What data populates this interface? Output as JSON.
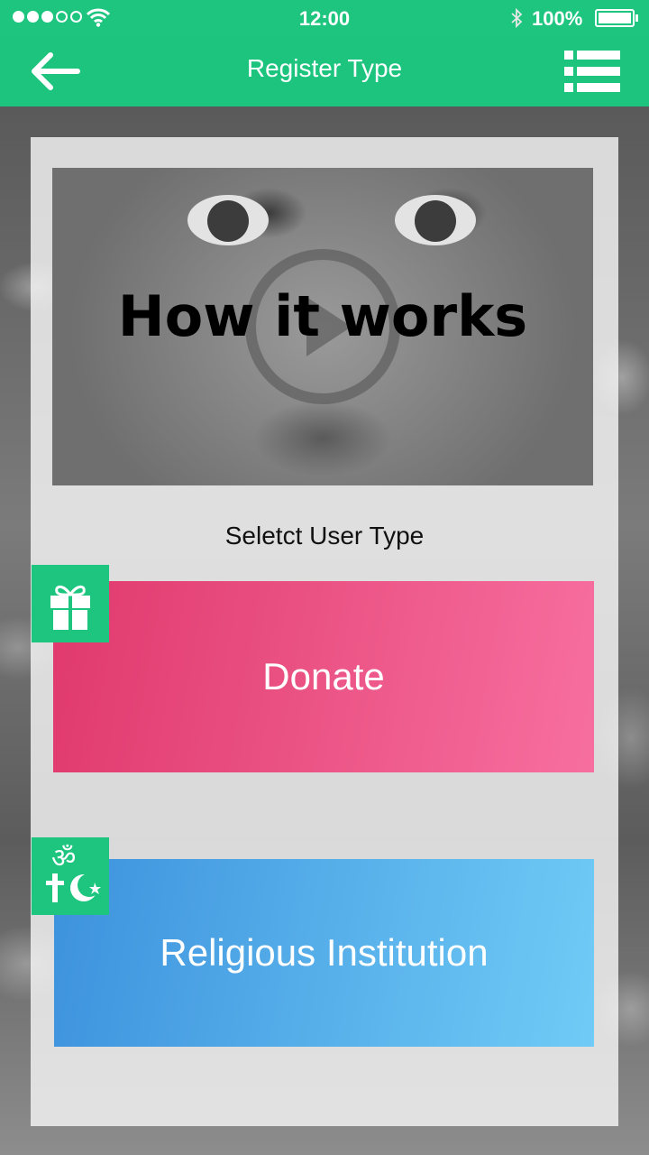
{
  "status_bar": {
    "time": "12:00",
    "battery_percent": "100%",
    "signal_dots_filled": 3,
    "signal_dots_total": 5,
    "icons": [
      "signal-dots-icon",
      "wifi-icon",
      "bluetooth-icon",
      "battery-icon"
    ]
  },
  "navbar": {
    "title": "Register Type",
    "back_icon": "back-arrow-icon",
    "menu_icon": "list-menu-icon",
    "color": "#1cc47e"
  },
  "video": {
    "title": "How it works",
    "icon": "play-icon"
  },
  "select_label": "Seletct User Type",
  "options": [
    {
      "label": "Donate",
      "icon": "gift-icon",
      "gradient": [
        "#e0396d",
        "#f76f9f"
      ]
    },
    {
      "label": "Religious Institution",
      "icon": "religious-symbols-icon",
      "gradient": [
        "#3d92dd",
        "#70cbf6"
      ]
    }
  ],
  "colors": {
    "accent": "#1dc57f"
  }
}
